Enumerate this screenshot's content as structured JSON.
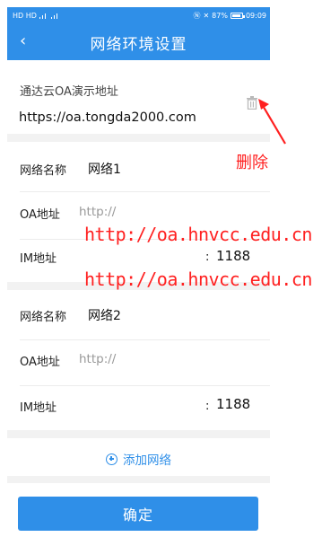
{
  "status_bar": {
    "left_text": "HD HD",
    "battery_text": "87%",
    "time": "09:09"
  },
  "header": {
    "back_icon": "chevron-left-icon",
    "title": "网络环境设置"
  },
  "demo": {
    "label": "通达云OA演示地址",
    "url": "https://oa.tongda2000.com",
    "delete_icon": "trash-icon"
  },
  "networks": [
    {
      "name_label": "网络名称",
      "name_value": "网络1",
      "oa_label": "OA地址",
      "oa_placeholder": "http://",
      "im_label": "IM地址",
      "im_colon": ":",
      "im_port": "1188"
    },
    {
      "name_label": "网络名称",
      "name_value": "网络2",
      "oa_label": "OA地址",
      "oa_placeholder": "http://",
      "im_label": "IM地址",
      "im_colon": ":",
      "im_port": "1188"
    }
  ],
  "add_network": {
    "icon": "plus-circle-icon",
    "label": "添加网络"
  },
  "confirm_label": "确定",
  "annotations": {
    "delete_note": "删除",
    "watermark_1": "http://oa.hnvcc.edu.cn",
    "watermark_2": "http://oa.hnvcc.edu.cn"
  },
  "colors": {
    "primary": "#2f8fe8",
    "annotation": "#ff2020",
    "band": "#f2f2f2"
  }
}
